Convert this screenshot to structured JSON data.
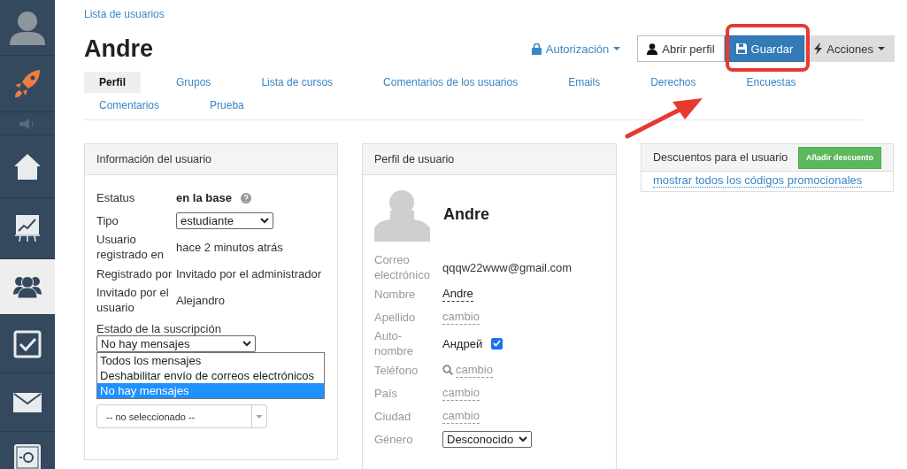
{
  "sidebar": {
    "items": [
      {
        "kind": "avatar",
        "selected": false
      },
      {
        "kind": "rocket",
        "selected": false
      },
      {
        "kind": "speaker",
        "selected": false
      },
      {
        "kind": "home",
        "selected": false
      },
      {
        "kind": "chart",
        "selected": false
      },
      {
        "kind": "users",
        "selected": true
      },
      {
        "kind": "check",
        "selected": false
      },
      {
        "kind": "mail",
        "selected": false
      },
      {
        "kind": "safe",
        "selected": false
      }
    ]
  },
  "breadcrumb": "Lista de usuarios",
  "title": "Andre",
  "actions": [
    {
      "kind": "auth",
      "label": "Autorización"
    },
    {
      "kind": "profile",
      "label": "Abrir perfil"
    },
    {
      "kind": "save",
      "label": "Guardar"
    },
    {
      "kind": "more",
      "label": "Acciones"
    }
  ],
  "tabs": [
    {
      "label": "Perfil",
      "selected": true
    },
    {
      "label": "Grupos",
      "selected": false
    },
    {
      "label": "Lista de cursos",
      "selected": false
    },
    {
      "label": "Comentarios de los usuarios",
      "selected": false
    },
    {
      "label": "Emails",
      "selected": false
    },
    {
      "label": "Derechos",
      "selected": false
    },
    {
      "label": "Encuestas",
      "selected": false
    },
    {
      "label": "Comentarios",
      "selected": false
    },
    {
      "label": "Prueba",
      "selected": false
    }
  ],
  "user_info": {
    "title": "Información del usuario",
    "fields": [
      {
        "kind": "status",
        "label": "Estatus",
        "value": "en la base"
      },
      {
        "kind": "select",
        "label": "Tipo",
        "value": "estudiante"
      },
      {
        "kind": "text",
        "label": "Usuario registrado en",
        "value": "hace 2 minutos atrás"
      },
      {
        "kind": "text",
        "label": "Registrado por",
        "value": "Invitado por el administrador"
      },
      {
        "kind": "text",
        "label": "Invitado por el usuario",
        "value": "Alejandro"
      }
    ],
    "subscription": {
      "label": "Estado de la suscripción",
      "value": "No hay mensajes",
      "expanded": true,
      "options": [
        {
          "label": "Todos los mensajes",
          "selected": false
        },
        {
          "label": "Deshabilitar envío de correos electrónicos",
          "selected": false
        },
        {
          "label": "No hay mensajes",
          "selected": true
        }
      ]
    },
    "account_select": {
      "value": "-- no seleccionado --"
    }
  },
  "profile": {
    "title": "Perfil de usuario",
    "name": "Andre",
    "fields": [
      {
        "kind": "text",
        "label": "Correo electrónico",
        "value": "qqqw22www@gmail.com"
      },
      {
        "kind": "editable",
        "label": "Nombre",
        "value": "Andre"
      },
      {
        "kind": "empty",
        "label": "Apellido",
        "value": "cambio"
      },
      {
        "kind": "checkbox",
        "label": "Auto-nombre",
        "value": "Андрей",
        "checked": true
      },
      {
        "kind": "phone",
        "label": "Teléfono",
        "value": "cambio"
      },
      {
        "kind": "empty",
        "label": "País",
        "value": "cambio"
      },
      {
        "kind": "empty",
        "label": "Ciudad",
        "value": "cambio"
      },
      {
        "kind": "select",
        "label": "Género",
        "value": "Desconocido"
      }
    ]
  },
  "discounts": {
    "title": "Descuentos para el usuario",
    "button": "Añadir descuento",
    "link": "mostrar todos los códigos promocionales"
  }
}
